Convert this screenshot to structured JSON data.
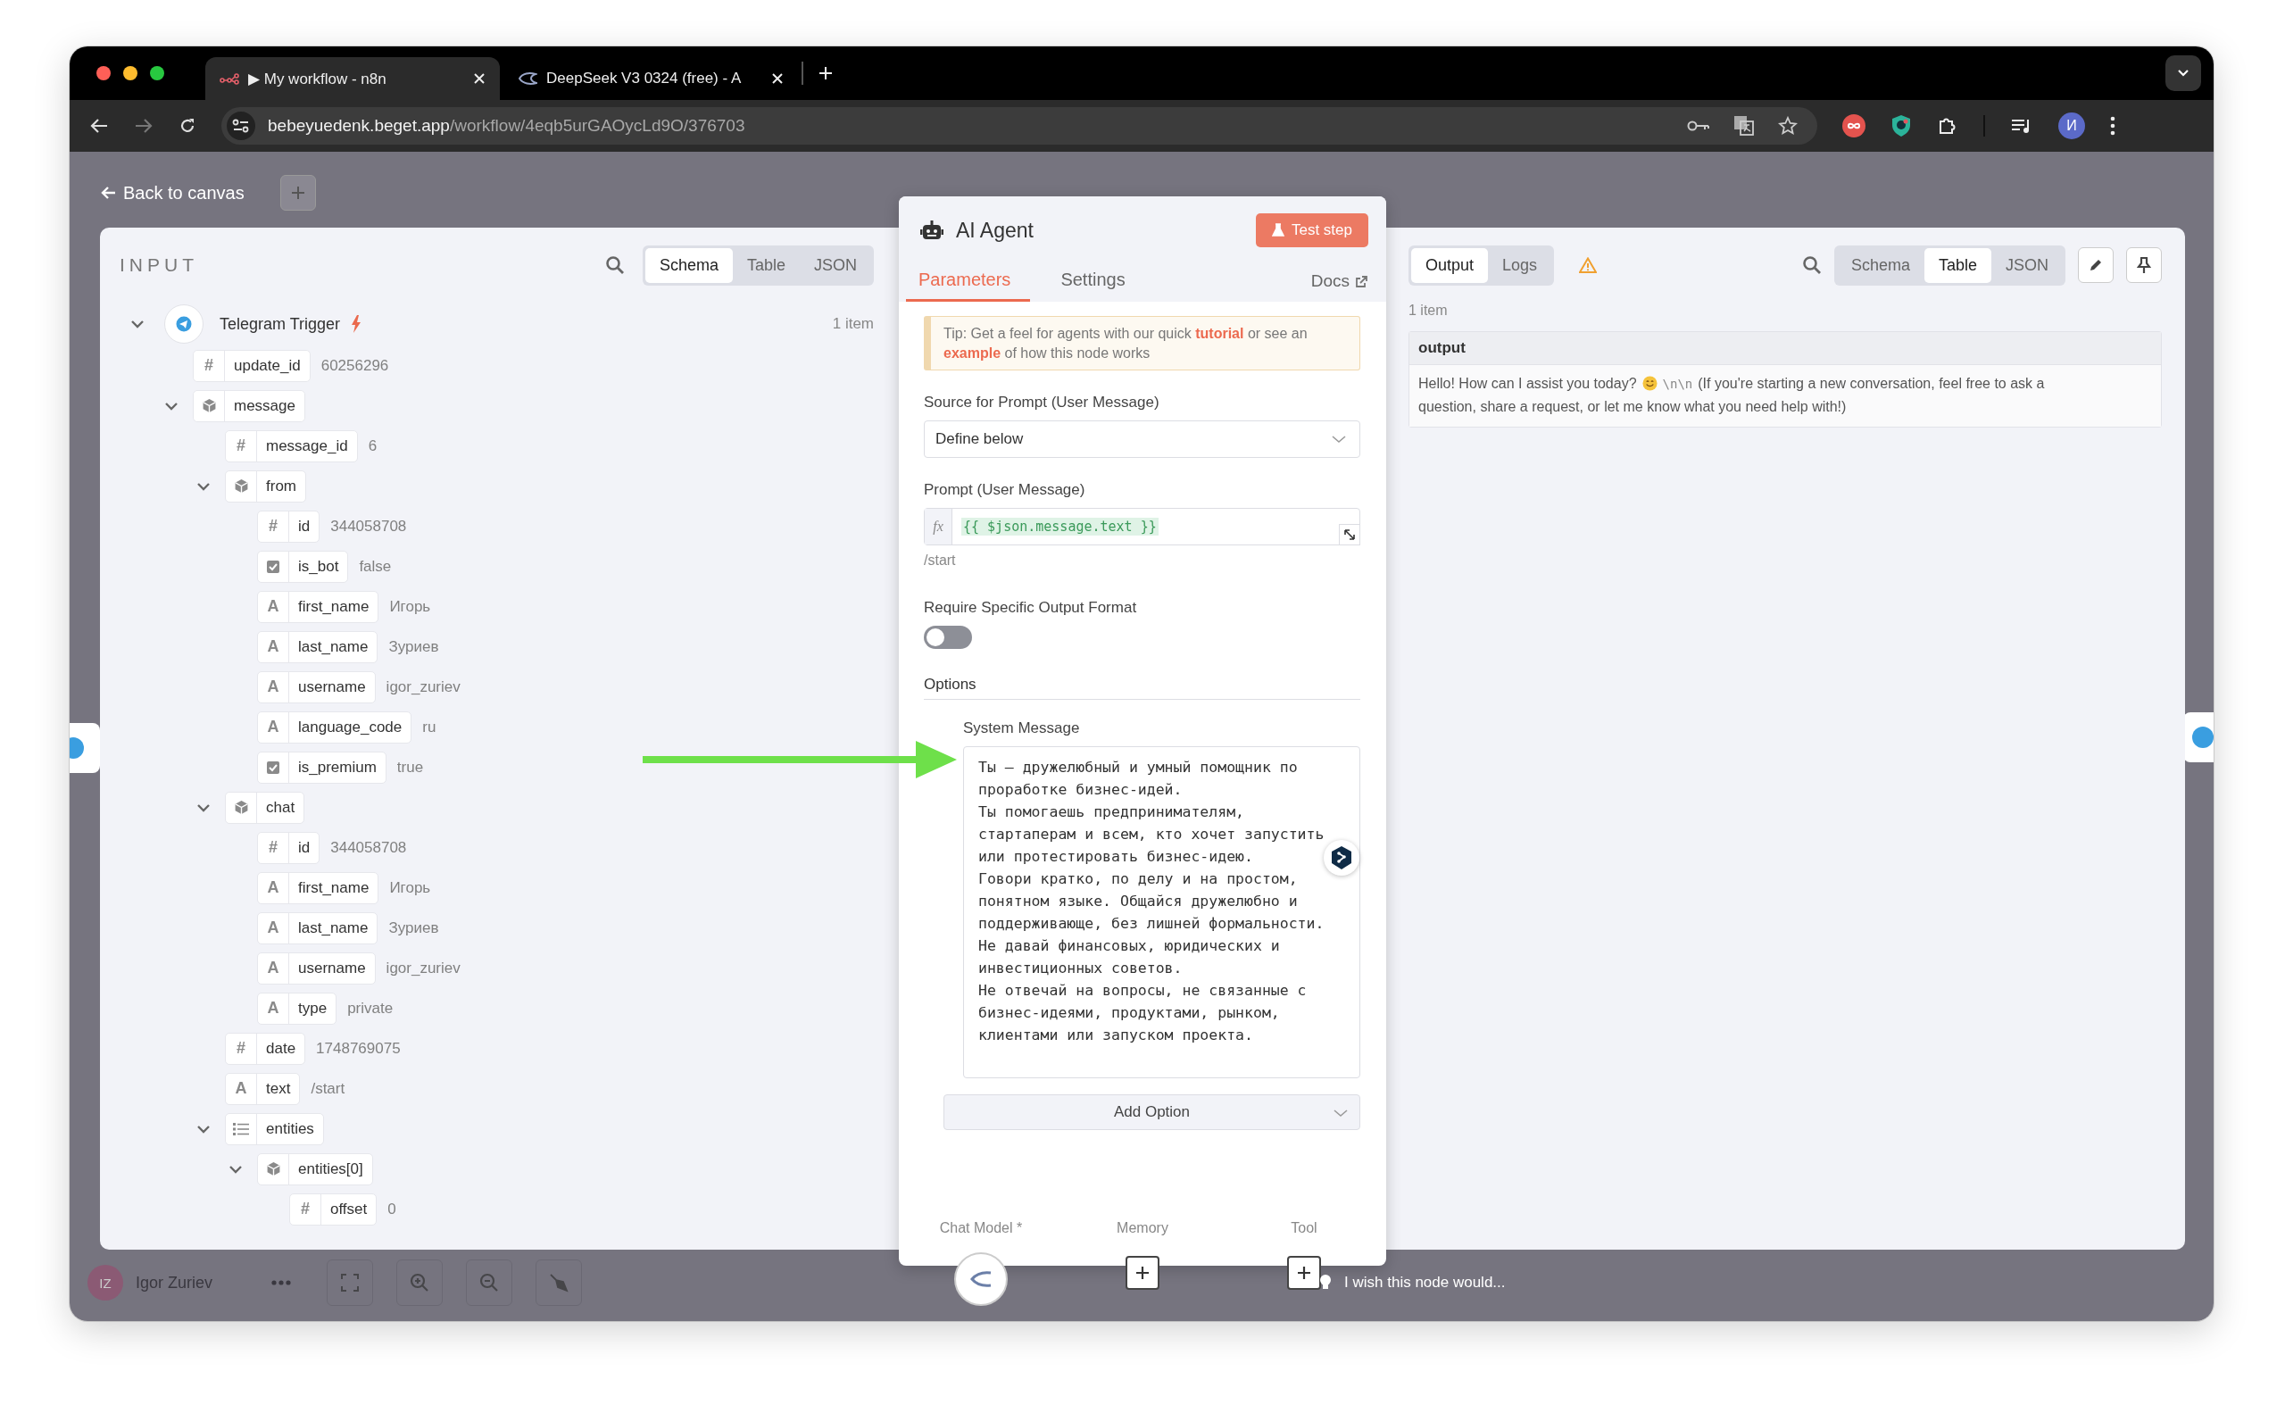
{
  "browser": {
    "tabs": [
      {
        "title": "▶ My workflow - n8n",
        "selected": true
      },
      {
        "title": "DeepSeek V3 0324 (free) - A",
        "selected": false
      }
    ],
    "forward_disabled": true,
    "url_domain": "bebeyuedenk.beget.app",
    "url_path": "/workflow/4eqb5urGAOycLd9O/376703",
    "profile_initial": "И"
  },
  "canvas": {
    "back_link": "Back to canvas",
    "user_initials": "IZ",
    "user_name": "Igor Zuriev",
    "feedback_placeholder": "I wish this node would..."
  },
  "input": {
    "title": "INPUT",
    "views": [
      {
        "label": "Schema",
        "selected": true
      },
      {
        "label": "Table",
        "selected": false
      },
      {
        "label": "JSON",
        "selected": false
      }
    ],
    "source": {
      "name": "Telegram Trigger",
      "count": "1 item",
      "expanded": true,
      "fields": [
        {
          "kind": "number",
          "type_icon": "#",
          "key": "update_id",
          "value": "60256296"
        },
        {
          "kind": "object",
          "key": "message",
          "expanded": true,
          "children": [
            {
              "kind": "number",
              "type_icon": "#",
              "key": "message_id",
              "value": "6"
            },
            {
              "kind": "object",
              "key": "from",
              "expanded": true,
              "children": [
                {
                  "kind": "number",
                  "type_icon": "#",
                  "key": "id",
                  "value": "344058708"
                },
                {
                  "kind": "boolean",
                  "key": "is_bot",
                  "value": "false"
                },
                {
                  "kind": "string",
                  "type_icon": "A",
                  "key": "first_name",
                  "value": "Игорь"
                },
                {
                  "kind": "string",
                  "type_icon": "A",
                  "key": "last_name",
                  "value": "Зуриев"
                },
                {
                  "kind": "string",
                  "type_icon": "A",
                  "key": "username",
                  "value": "igor_zuriev"
                },
                {
                  "kind": "string",
                  "type_icon": "A",
                  "key": "language_code",
                  "value": "ru"
                },
                {
                  "kind": "boolean",
                  "key": "is_premium",
                  "value": "true"
                }
              ]
            },
            {
              "kind": "object",
              "key": "chat",
              "expanded": true,
              "children": [
                {
                  "kind": "number",
                  "type_icon": "#",
                  "key": "id",
                  "value": "344058708"
                },
                {
                  "kind": "string",
                  "type_icon": "A",
                  "key": "first_name",
                  "value": "Игорь"
                },
                {
                  "kind": "string",
                  "type_icon": "A",
                  "key": "last_name",
                  "value": "Зуриев"
                },
                {
                  "kind": "string",
                  "type_icon": "A",
                  "key": "username",
                  "value": "igor_zuriev"
                },
                {
                  "kind": "string",
                  "type_icon": "A",
                  "key": "type",
                  "value": "private"
                }
              ]
            },
            {
              "kind": "number",
              "type_icon": "#",
              "key": "date",
              "value": "1748769075"
            },
            {
              "kind": "string",
              "type_icon": "A",
              "key": "text",
              "value": "/start"
            },
            {
              "kind": "array",
              "key": "entities",
              "expanded": true,
              "children": [
                {
                  "kind": "object",
                  "key": "entities[0]",
                  "expanded": true,
                  "children": [
                    {
                      "kind": "number",
                      "type_icon": "#",
                      "key": "offset",
                      "value": "0"
                    }
                  ]
                }
              ]
            }
          ]
        }
      ]
    }
  },
  "node": {
    "title": "AI Agent",
    "test_button": "Test step",
    "tabs": [
      {
        "label": "Parameters",
        "selected": true
      },
      {
        "label": "Settings",
        "selected": false
      }
    ],
    "docs_link": "Docs",
    "tip": [
      {
        "kind": "text",
        "text": "Tip: Get a feel for agents with our quick"
      },
      {
        "kind": "link",
        "text": "tutorial"
      },
      {
        "kind": "text",
        "text": "or see an"
      },
      {
        "kind": "link",
        "text": "example"
      },
      {
        "kind": "text",
        "text": "of how this node works"
      }
    ],
    "source_label": "Source for Prompt (User Message)",
    "source_value": "Define below",
    "prompt_label": "Prompt (User Message)",
    "prompt_mode_icon": "fx",
    "prompt_expression": "{{ $json.message.text }}",
    "prompt_preview": "/start",
    "output_format_label": "Require Specific Output Format",
    "output_format_on": false,
    "options_title": "Options",
    "system_message_label": "System Message",
    "system_message": "Ты — дружелюбный и умный помощник по проработке бизнес-идей.\nТы помогаешь предпринимателям, стартаперам и всем, кто хочет запустить или протестировать бизнес-идею.\nГовори кратко, по делу и на простом, понятном языке. Общайся дружелюбно и поддерживающе, без лишней формальности.\nНе давай финансовых, юридических и инвестиционных советов.\nНе отвечай на вопросы, не связанные с бизнес-идеями, продуктами, рынком, клиентами или запуском проекта.",
    "add_option": "Add Option",
    "connectors": [
      {
        "label": "Chat Model *",
        "kind": "model"
      },
      {
        "label": "Memory",
        "kind": "add"
      },
      {
        "label": "Tool",
        "kind": "add"
      }
    ]
  },
  "output": {
    "tabs": [
      {
        "label": "Output",
        "selected": true
      },
      {
        "label": "Logs",
        "selected": false
      }
    ],
    "views": [
      {
        "label": "Schema",
        "selected": false
      },
      {
        "label": "Table",
        "selected": true
      },
      {
        "label": "JSON",
        "selected": false
      }
    ],
    "count": "1 item",
    "table": {
      "columns": [
        "output"
      ],
      "rows": [
        [
          {
            "kind": "text",
            "text": "Hello! How can I assist you today?"
          },
          {
            "kind": "smiley"
          },
          {
            "kind": "code",
            "text": "\\n\\n"
          },
          {
            "kind": "text",
            "text": "(If you're starting a new conversation, feel free to ask a"
          },
          {
            "kind": "text",
            "text": "question, share a request, or let me know what you need help with!)"
          }
        ]
      ]
    }
  }
}
